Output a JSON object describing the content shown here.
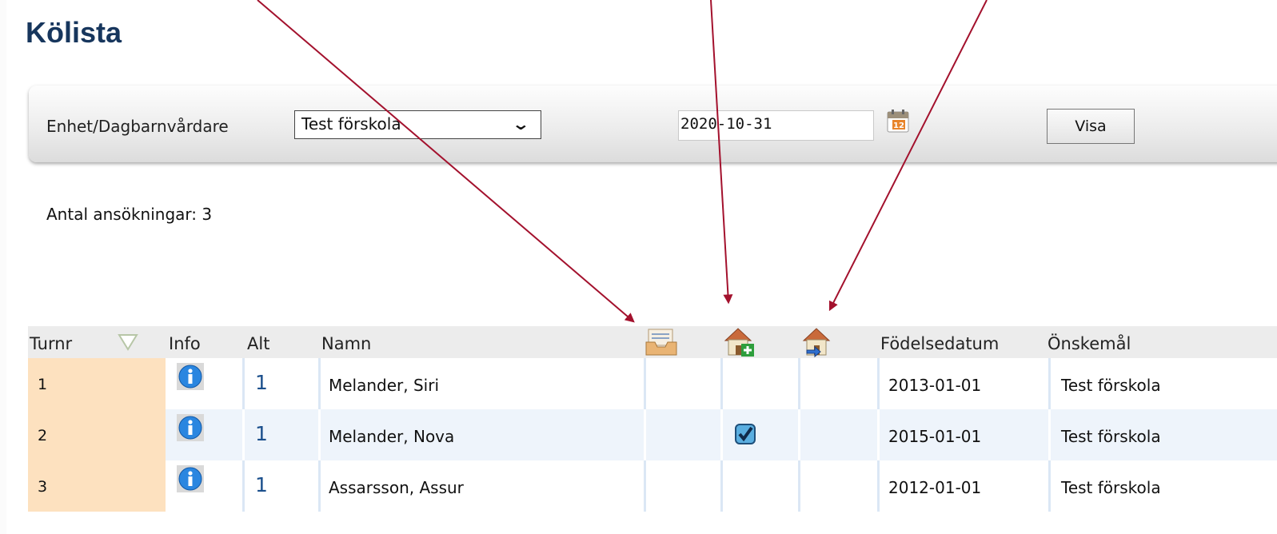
{
  "page": {
    "title": "Kölista"
  },
  "filters": {
    "unit_label": "Enhet/Dagbarnvårdare",
    "unit_selected": "Test förskola",
    "date_value": "2020-10-31",
    "show_button_label": "Visa"
  },
  "summary": {
    "count_text": "Antal ansökningar: 3"
  },
  "table": {
    "headers": {
      "turnr": "Turnr",
      "info": "Info",
      "alt": "Alt",
      "namn": "Namn",
      "fodelsedatum": "Födelsedatum",
      "onskemal": "Önskemål"
    },
    "header_icons": [
      "inbox-tray-icon",
      "house-add-icon",
      "house-move-icon"
    ],
    "rows": [
      {
        "turnr": "1",
        "alt": "1",
        "namn": "Melander, Siri",
        "fodelsedatum": "2013-01-01",
        "onskemal": "Test förskola",
        "house_add_checked": false
      },
      {
        "turnr": "2",
        "alt": "1",
        "namn": "Melander, Nova",
        "fodelsedatum": "2015-01-01",
        "onskemal": "Test förskola",
        "house_add_checked": true
      },
      {
        "turnr": "3",
        "alt": "1",
        "namn": "Assarsson, Assur",
        "fodelsedatum": "2012-01-01",
        "onskemal": "Test förskola",
        "house_add_checked": false
      }
    ]
  },
  "colors": {
    "title": "#17365d",
    "turn_cell": "#fde1bf",
    "alt_link": "#1b4f8c",
    "annotation_arrow": "#a3112d"
  }
}
